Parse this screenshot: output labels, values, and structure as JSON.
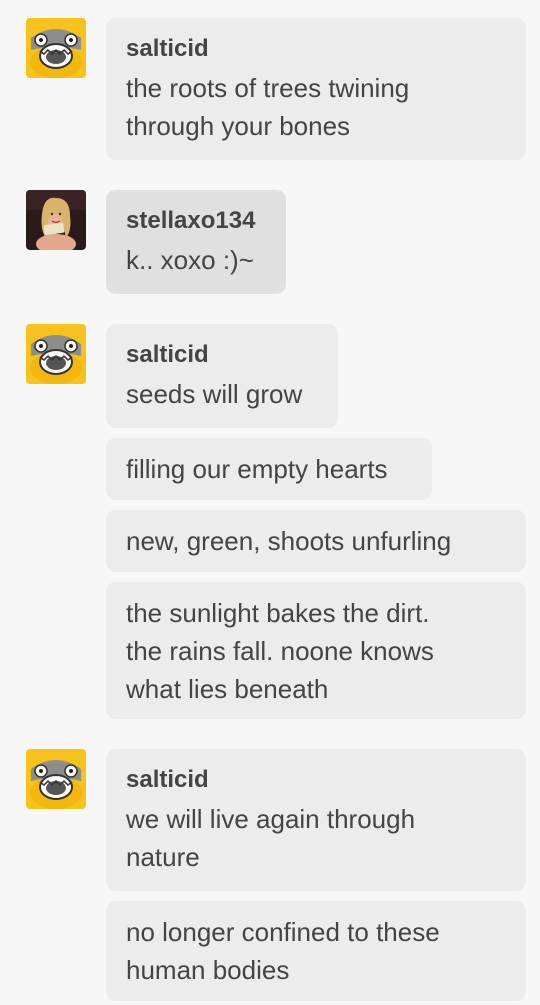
{
  "colors": {
    "background": "#f7f7f7",
    "bubble": "#ececec",
    "bubble_active": "#e0e0e0",
    "text": "#444444",
    "avatar_yellow": "#f7c21b"
  },
  "icons": {
    "salticid_avatar": "yellow-screaming-face-icon",
    "stella_avatar": "user-photo-avatar"
  },
  "messages": [
    {
      "user": "salticid",
      "text": "the roots of trees twining\nthrough your bones"
    },
    {
      "user": "stellaxo134",
      "text": "k.. xoxo :)~"
    },
    {
      "user": "salticid",
      "text": "seeds will grow"
    },
    {
      "text": "filling our empty hearts"
    },
    {
      "text": "new, green, shoots unfurling"
    },
    {
      "text": "the sunlight bakes the dirt.\nthe rains fall.  noone knows\nwhat lies beneath"
    },
    {
      "user": "salticid",
      "text": "we will live again through\nnature"
    },
    {
      "text": "no longer confined to these\nhuman bodies"
    }
  ]
}
